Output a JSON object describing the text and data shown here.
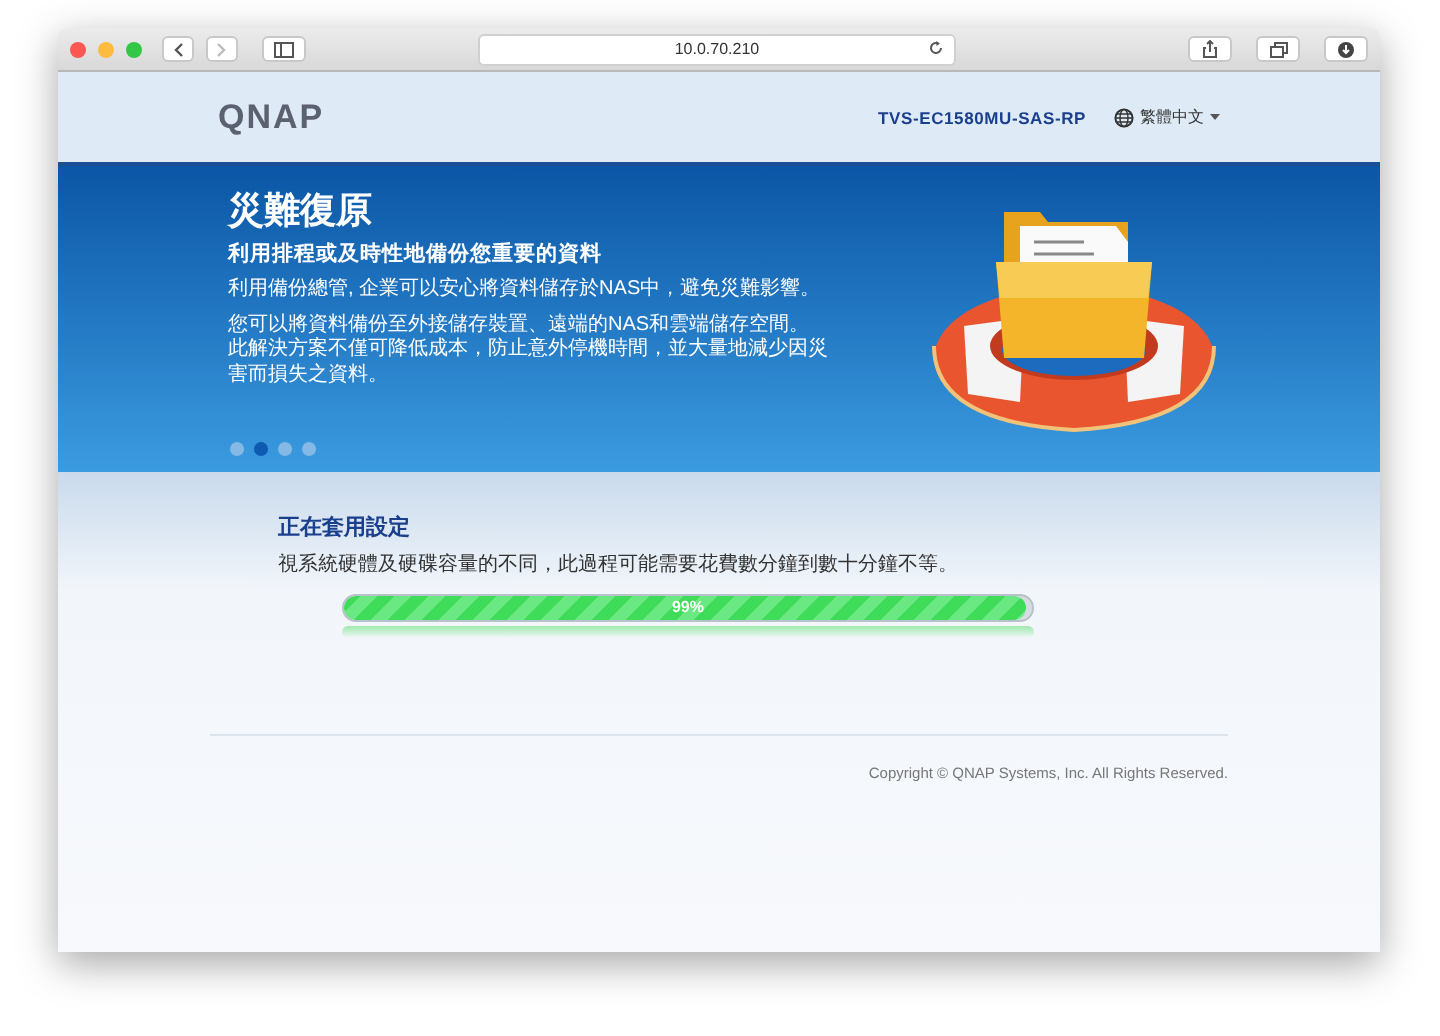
{
  "browser": {
    "address": "10.0.70.210"
  },
  "header": {
    "logo": "QNAP",
    "model": "TVS-EC1580MU-SAS-RP",
    "language": "繁體中文"
  },
  "banner": {
    "title": "災難復原",
    "subtitle": "利用排程或及時性地備份您重要的資料",
    "lines": [
      "利用備份總管, 企業可以安心將資料儲存於NAS中，避免災難影響。",
      "您可以將資料備份至外接儲存裝置、遠端的NAS和雲端儲存空間。此解決方案不僅可降低成本，防止意外停機時間，並大量地減少因災害而損失之資料。"
    ],
    "dots": [
      {
        "selected": false
      },
      {
        "selected": true
      },
      {
        "selected": false
      },
      {
        "selected": false
      }
    ]
  },
  "progress": {
    "title": "正在套用設定",
    "note": "視系統硬體及硬碟容量的不同，此過程可能需要花費數分鐘到數十分鐘不等。",
    "level": 0.99,
    "label": "99%"
  },
  "footer": {
    "copyright": "Copyright © QNAP Systems, Inc. All Rights Reserved."
  }
}
